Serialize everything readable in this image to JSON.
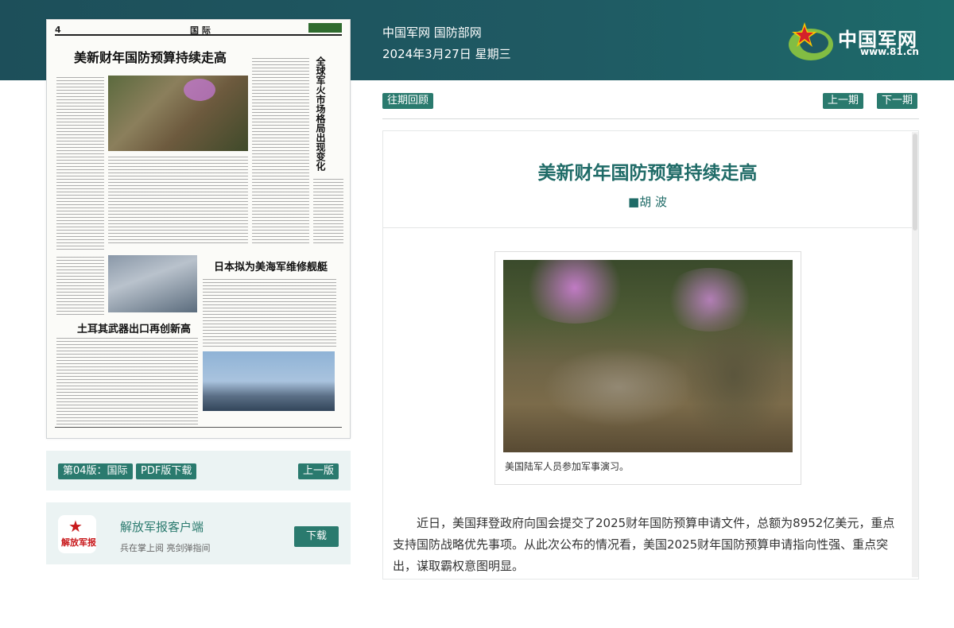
{
  "header": {
    "site_names": "中国军网 国防部网",
    "date": "2024年3月27日 星期三",
    "logo_text": "中国军网",
    "logo_url": "www.81.cn"
  },
  "newspaper": {
    "page_number": "4",
    "section": "国 际",
    "headline_main": "美新财年国防预算持续走高",
    "headline_vertical": "全球军火市场格局出现变化",
    "headline_second": "日本拟为美海军维修舰艇",
    "headline_third": "土耳其武器出口再创新高"
  },
  "edition_bar": {
    "edition_label": "第04版：国际",
    "pdf_label": "PDF版下载",
    "prev_edition": "上一版"
  },
  "client": {
    "icon_text": "解放军报",
    "title": "解放军报客户端",
    "subtitle": "兵在掌上阅 亮剑弹指间",
    "download": "下载"
  },
  "nav": {
    "archive": "往期回顾",
    "prev_issue": "上一期",
    "next_issue": "下一期"
  },
  "article": {
    "title": "美新财年国防预算持续走高",
    "author": "■胡 波",
    "caption": "美国陆军人员参加军事演习。",
    "paragraph": "近日，美国拜登政府向国会提交了2025财年国防预算申请文件，总额为8952亿美元，重点支持国防战略优先事项。从此次公布的情况看，美国2025财年国防预算申请指向性强、重点突出，谋取霸权意图明显。"
  }
}
